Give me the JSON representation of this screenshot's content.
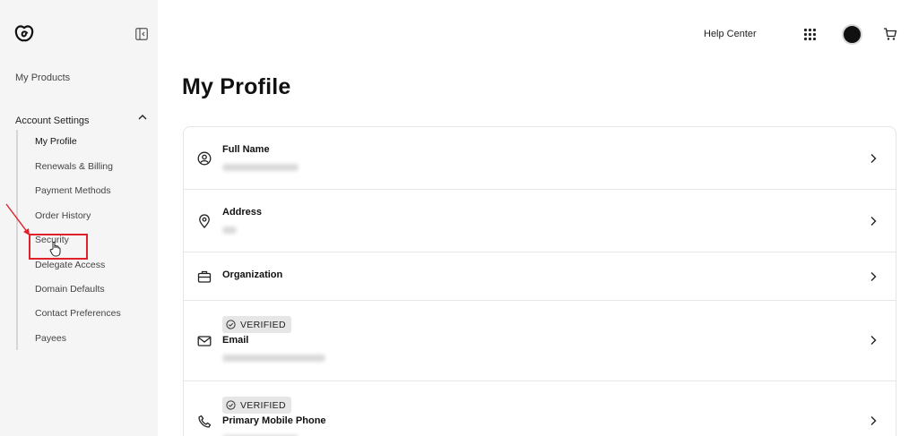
{
  "sidebar": {
    "my_products": "My Products",
    "account_settings": "Account Settings",
    "items": [
      {
        "label": "My Profile"
      },
      {
        "label": "Renewals & Billing"
      },
      {
        "label": "Payment Methods"
      },
      {
        "label": "Order History"
      },
      {
        "label": "Security"
      },
      {
        "label": "Delegate Access"
      },
      {
        "label": "Domain Defaults"
      },
      {
        "label": "Contact Preferences"
      },
      {
        "label": "Payees"
      }
    ]
  },
  "header": {
    "help_center": "Help Center"
  },
  "main": {
    "title": "My Profile",
    "rows": [
      {
        "label": "Full Name",
        "icon": "user-circle-icon"
      },
      {
        "label": "Address",
        "icon": "location-pin-icon"
      },
      {
        "label": "Organization",
        "icon": "briefcase-icon"
      },
      {
        "label": "Email",
        "badge": "VERIFIED",
        "icon": "mail-icon"
      },
      {
        "label": "Primary Mobile Phone",
        "badge": "VERIFIED",
        "icon": "phone-icon"
      }
    ]
  },
  "colors": {
    "sidebar_bg": "#f5f5f5",
    "highlight": "#e0202a",
    "badge_bg": "#e6e6e6"
  }
}
